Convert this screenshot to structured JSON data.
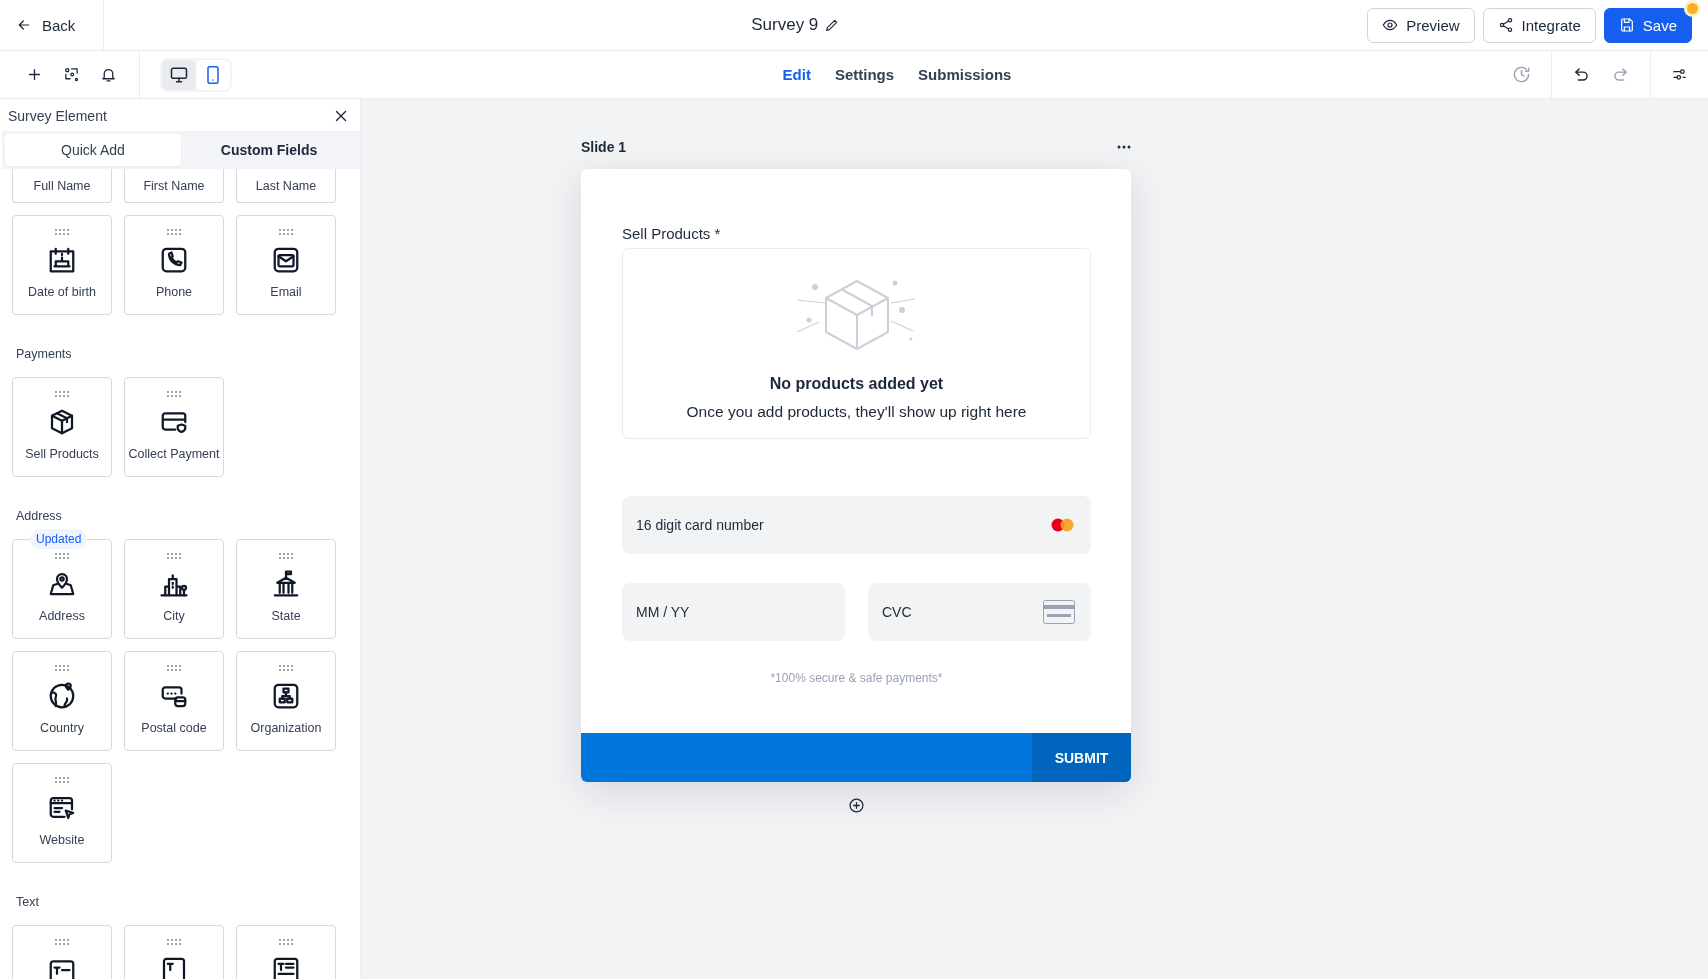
{
  "header": {
    "back_label": "Back",
    "title": "Survey 9",
    "buttons": [
      {
        "label": "Preview",
        "kind": "preview"
      },
      {
        "label": "Integrate",
        "kind": "integrate"
      },
      {
        "label": "Save",
        "kind": "save"
      }
    ]
  },
  "toolbar": {
    "devices": [
      {
        "kind": "desktop",
        "selected": false
      },
      {
        "kind": "mobile",
        "selected": true
      }
    ],
    "tabs": [
      {
        "label": "Edit",
        "selected": true
      },
      {
        "label": "Settings",
        "selected": false
      },
      {
        "label": "Submissions",
        "selected": false
      }
    ],
    "actions": [
      {
        "kind": "history",
        "disabled": true
      },
      {
        "kind": "undo",
        "disabled": false
      },
      {
        "kind": "redo",
        "disabled": true
      }
    ]
  },
  "panel": {
    "title": "Survey Element",
    "tabs": [
      {
        "label": "Quick Add",
        "selected": true
      },
      {
        "label": "Custom Fields",
        "selected": false
      }
    ],
    "sections": [
      {
        "items": [
          {
            "label": "Full Name"
          },
          {
            "label": "First Name"
          },
          {
            "label": "Last Name"
          }
        ]
      },
      {
        "items": [
          {
            "label": "Date of birth",
            "kind": "cake"
          },
          {
            "label": "Phone",
            "kind": "phone"
          },
          {
            "label": "Email",
            "kind": "mail"
          }
        ]
      },
      {
        "heading": "Payments",
        "items": [
          {
            "label": "Sell Products",
            "kind": "box"
          },
          {
            "label": "Collect Payment",
            "kind": "card"
          }
        ]
      },
      {
        "heading": "Address",
        "items": [
          {
            "label": "Address",
            "kind": "pin",
            "badge": "Updated"
          },
          {
            "label": "City",
            "kind": "city"
          },
          {
            "label": "State",
            "kind": "capitol"
          },
          {
            "label": "Country",
            "kind": "globe"
          },
          {
            "label": "Postal code",
            "kind": "postal"
          },
          {
            "label": "Organization",
            "kind": "org"
          },
          {
            "label": "Website",
            "kind": "web"
          }
        ]
      },
      {
        "heading": "Text",
        "items": [
          {
            "kind": "t-line"
          },
          {
            "kind": "t-box"
          },
          {
            "kind": "t-lines"
          }
        ]
      }
    ]
  },
  "canvas": {
    "slide_title": "Slide 1",
    "field_label": "Sell Products *",
    "empty_title": "No products added yet",
    "empty_message": "Once you add products, they'll show up right here",
    "card_number": {
      "placeholder": "16 digit card number"
    },
    "expiry": {
      "placeholder": "MM / YY"
    },
    "cvc": {
      "placeholder": "CVC"
    },
    "note": "*100% secure & safe payments*",
    "submit": "SUBMIT"
  }
}
